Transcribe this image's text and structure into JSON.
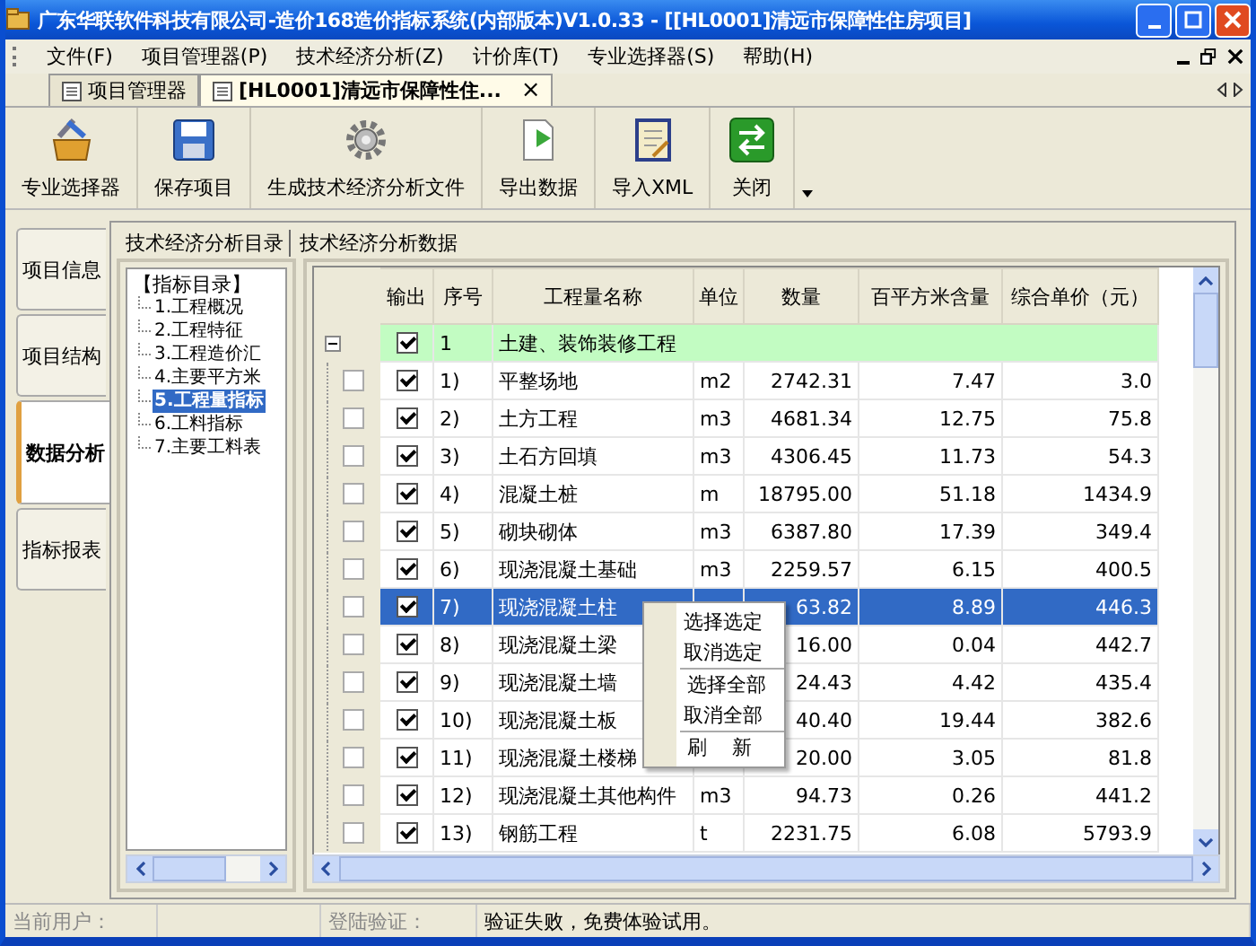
{
  "window": {
    "title": "广东华联软件科技有限公司-造价168造价指标系统(内部版本)V1.0.33 - [[HL0001]清远市保障性住房项目]"
  },
  "menu": [
    "文件(F)",
    "项目管理器(P)",
    "技术经济分析(Z)",
    "计价库(T)",
    "专业选择器(S)",
    "帮助(H)"
  ],
  "doc_tabs": [
    {
      "label": "项目管理器",
      "selected": false
    },
    {
      "label": "[HL0001]清远市保障性住...",
      "selected": true,
      "close": "×"
    }
  ],
  "toolbar": [
    {
      "label": "专业选择器",
      "kind": "toolbox"
    },
    {
      "label": "保存项目",
      "kind": "save"
    },
    {
      "label": "生成技术经济分析文件",
      "kind": "gear"
    },
    {
      "label": "导出数据",
      "kind": "export"
    },
    {
      "label": "导入XML",
      "kind": "import"
    },
    {
      "label": "关闭",
      "kind": "close"
    }
  ],
  "side_tabs": [
    {
      "label": "项目信息",
      "selected": false
    },
    {
      "label": "项目结构",
      "selected": false
    },
    {
      "label": "数据分析",
      "selected": true
    },
    {
      "label": "指标报表",
      "selected": false
    }
  ],
  "panel_tabs": [
    "技术经济分析目录",
    "技术经济分析数据"
  ],
  "tree": {
    "root": "【指标目录】",
    "children": [
      {
        "label": "1.工程概况",
        "selected": false
      },
      {
        "label": "2.工程特征",
        "selected": false
      },
      {
        "label": "3.工程造价汇",
        "selected": false
      },
      {
        "label": "4.主要平方米",
        "selected": false
      },
      {
        "label": "5.工程量指标",
        "selected": true
      },
      {
        "label": "6.工料指标",
        "selected": false
      },
      {
        "label": "7.主要工料表",
        "selected": false
      }
    ]
  },
  "table": {
    "columns": [
      "输出",
      "序号",
      "工程量名称",
      "单位",
      "数量",
      "百平方米含量",
      "综合单价（元）"
    ],
    "group": {
      "expanded": true,
      "output": true,
      "no": "1",
      "name": "土建、装饰装修工程"
    },
    "rows": [
      {
        "marked": false,
        "output": true,
        "no": "1)",
        "name": "平整场地",
        "unit": "m2",
        "qty": "2742.31",
        "per100": "7.47",
        "price": "3.0",
        "selected": false
      },
      {
        "marked": false,
        "output": true,
        "no": "2)",
        "name": "土方工程",
        "unit": "m3",
        "qty": "4681.34",
        "per100": "12.75",
        "price": "75.8",
        "selected": false
      },
      {
        "marked": false,
        "output": true,
        "no": "3)",
        "name": "土石方回填",
        "unit": "m3",
        "qty": "4306.45",
        "per100": "11.73",
        "price": "54.3",
        "selected": false
      },
      {
        "marked": false,
        "output": true,
        "no": "4)",
        "name": "混凝土桩",
        "unit": "m",
        "qty": "18795.00",
        "per100": "51.18",
        "price": "1434.9",
        "selected": false
      },
      {
        "marked": false,
        "output": true,
        "no": "5)",
        "name": "砌块砌体",
        "unit": "m3",
        "qty": "6387.80",
        "per100": "17.39",
        "price": "349.4",
        "selected": false
      },
      {
        "marked": false,
        "output": true,
        "no": "6)",
        "name": "现浇混凝土基础",
        "unit": "m3",
        "qty": "2259.57",
        "per100": "6.15",
        "price": "400.5",
        "selected": false
      },
      {
        "marked": false,
        "output": true,
        "no": "7)",
        "name": "现浇混凝土柱",
        "qty": "63.82",
        "per100": "8.89",
        "price": "446.3",
        "selected": true
      },
      {
        "marked": false,
        "output": true,
        "no": "8)",
        "name": "现浇混凝土梁",
        "qty": "16.00",
        "per100": "0.04",
        "price": "442.7",
        "selected": false
      },
      {
        "marked": false,
        "output": true,
        "no": "9)",
        "name": "现浇混凝土墙",
        "qty": "24.43",
        "per100": "4.42",
        "price": "435.4",
        "selected": false
      },
      {
        "marked": false,
        "output": true,
        "no": "10)",
        "name": "现浇混凝土板",
        "qty": "40.40",
        "per100": "19.44",
        "price": "382.6",
        "selected": false
      },
      {
        "marked": false,
        "output": true,
        "no": "11)",
        "name": "现浇混凝土楼梯",
        "qty": "20.00",
        "per100": "3.05",
        "price": "81.8",
        "selected": false
      },
      {
        "marked": false,
        "output": true,
        "no": "12)",
        "name": "现浇混凝土其他构件",
        "unit": "m3",
        "qty": "94.73",
        "per100": "0.26",
        "price": "441.2",
        "selected": false
      },
      {
        "marked": false,
        "output": true,
        "no": "13)",
        "name": "钢筋工程",
        "unit": "t",
        "qty": "2231.75",
        "per100": "6.08",
        "price": "5793.9",
        "selected": false
      }
    ]
  },
  "context_menu": [
    {
      "label": "选择选定",
      "separator_before": false
    },
    {
      "label": "取消选定",
      "separator_before": false
    },
    {
      "label": "选择全部",
      "separator_before": true
    },
    {
      "label": "取消全部",
      "separator_before": false
    },
    {
      "label": "刷    新",
      "separator_before": true
    }
  ],
  "status_bar": {
    "user_label": "当前用户：",
    "login_label": "登陆验证：",
    "message": "验证失败，免费体验试用。"
  }
}
